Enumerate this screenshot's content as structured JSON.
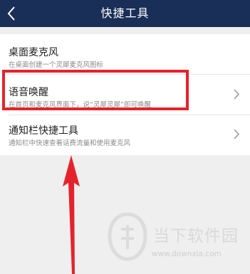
{
  "header": {
    "title": "快捷工具",
    "back_icon": "chevron-left-icon"
  },
  "items": [
    {
      "title": "桌面麦克风",
      "desc": "在桌面创建一个灵犀麦克风图标",
      "has_chevron": false
    },
    {
      "title": "语音唤醒",
      "desc": "在首页和麦克风界面下，说“灵犀灵犀”即可唤醒",
      "has_chevron": true
    },
    {
      "title": "通知栏快捷工具",
      "desc": "通知栏中快速查看话费流量和使用麦克风",
      "has_chevron": true
    }
  ],
  "annotation": {
    "highlight_color": "#e5232c",
    "arrow_color": "#e5232c"
  },
  "watermark": {
    "name": "当下软件园",
    "url": "www.downxia.com"
  },
  "colors": {
    "titlebar": "#1a2f57",
    "background": "#efefef",
    "card": "#ffffff"
  }
}
